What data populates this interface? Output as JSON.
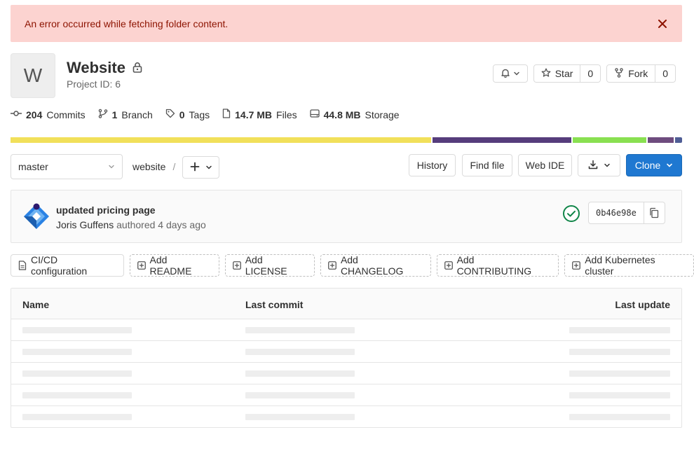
{
  "alert": {
    "message": "An error occurred while fetching folder content.",
    "close_icon": "close-icon"
  },
  "project": {
    "avatar_letter": "W",
    "name": "Website",
    "id_label": "Project ID: 6",
    "visibility_icon": "lock-icon"
  },
  "actions": {
    "notification_icon": "bell-icon",
    "star_label": "Star",
    "star_count": "0",
    "fork_label": "Fork",
    "fork_count": "0"
  },
  "stats": {
    "commits_count": "204",
    "commits_label": "Commits",
    "branches_count": "1",
    "branches_label": "Branch",
    "tags_count": "0",
    "tags_label": "Tags",
    "files_size": "14.7 MB",
    "files_label": "Files",
    "storage_size": "44.8 MB",
    "storage_label": "Storage"
  },
  "language_bar": {
    "segments": [
      {
        "color": "#f1e05a",
        "percent": 63.0
      },
      {
        "color": "#563d7c",
        "percent": 20.8
      },
      {
        "color": "#89e051",
        "percent": 11.0
      },
      {
        "color": "#6e4c7e",
        "percent": 3.9
      },
      {
        "color": "#4f5d95",
        "percent": 1.0
      }
    ]
  },
  "toolbar": {
    "branch": "master",
    "path_root": "website",
    "path_separator": "/",
    "history": "History",
    "find_file": "Find file",
    "web_ide": "Web IDE",
    "clone": "Clone"
  },
  "commit": {
    "title": "updated pricing page",
    "author": "Joris Guffens",
    "authored_text": "authored 4 days ago",
    "sha": "0b46e98e",
    "status": "passed"
  },
  "quick_actions": [
    {
      "label": "CI/CD configuration",
      "style": "solid"
    },
    {
      "label": "Add README",
      "style": "dashed"
    },
    {
      "label": "Add LICENSE",
      "style": "dashed"
    },
    {
      "label": "Add CHANGELOG",
      "style": "dashed"
    },
    {
      "label": "Add CONTRIBUTING",
      "style": "dashed"
    },
    {
      "label": "Add Kubernetes cluster",
      "style": "dashed"
    }
  ],
  "file_table": {
    "headers": {
      "name": "Name",
      "last_commit": "Last commit",
      "last_update": "Last update"
    },
    "loading_rows": 5
  }
}
